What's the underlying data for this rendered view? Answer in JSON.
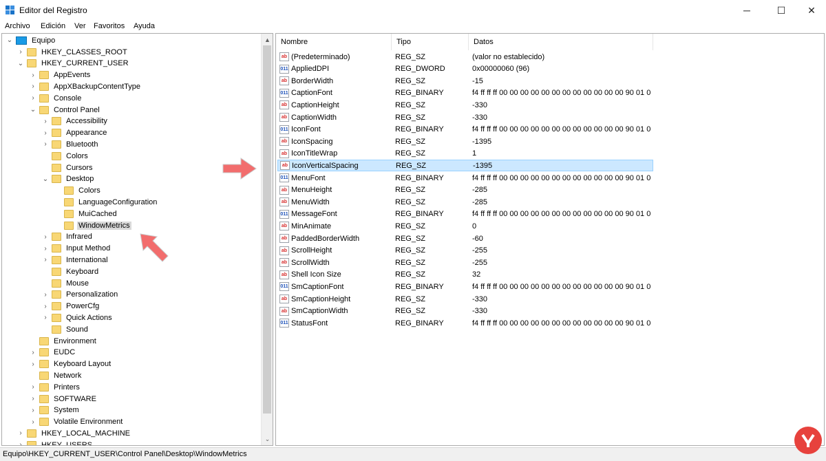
{
  "window": {
    "title": "Editor del Registro",
    "minimize": "─",
    "maximize": "☐",
    "close": "✕"
  },
  "menu": [
    "Archivo",
    "Edición",
    "Ver",
    "Favoritos",
    "Ayuda"
  ],
  "tree": {
    "root": "Equipo",
    "items": [
      {
        "label": "HKEY_CLASSES_ROOT",
        "level": 1,
        "expander": "›"
      },
      {
        "label": "HKEY_CURRENT_USER",
        "level": 1,
        "expander": "⌄"
      },
      {
        "label": "AppEvents",
        "level": 2,
        "expander": "›"
      },
      {
        "label": "AppXBackupContentType",
        "level": 2,
        "expander": "›"
      },
      {
        "label": "Console",
        "level": 2,
        "expander": "›"
      },
      {
        "label": "Control Panel",
        "level": 2,
        "expander": "⌄"
      },
      {
        "label": "Accessibility",
        "level": 3,
        "expander": "›"
      },
      {
        "label": "Appearance",
        "level": 3,
        "expander": "›"
      },
      {
        "label": "Bluetooth",
        "level": 3,
        "expander": "›"
      },
      {
        "label": "Colors",
        "level": 3,
        "expander": ""
      },
      {
        "label": "Cursors",
        "level": 3,
        "expander": ""
      },
      {
        "label": "Desktop",
        "level": 3,
        "expander": "⌄"
      },
      {
        "label": "Colors",
        "level": 4,
        "expander": ""
      },
      {
        "label": "LanguageConfiguration",
        "level": 4,
        "expander": ""
      },
      {
        "label": "MuiCached",
        "level": 4,
        "expander": ""
      },
      {
        "label": "WindowMetrics",
        "level": 4,
        "expander": "",
        "selected": true
      },
      {
        "label": "Infrared",
        "level": 3,
        "expander": "›"
      },
      {
        "label": "Input Method",
        "level": 3,
        "expander": "›"
      },
      {
        "label": "International",
        "level": 3,
        "expander": "›"
      },
      {
        "label": "Keyboard",
        "level": 3,
        "expander": ""
      },
      {
        "label": "Mouse",
        "level": 3,
        "expander": ""
      },
      {
        "label": "Personalization",
        "level": 3,
        "expander": "›"
      },
      {
        "label": "PowerCfg",
        "level": 3,
        "expander": "›"
      },
      {
        "label": "Quick Actions",
        "level": 3,
        "expander": "›"
      },
      {
        "label": "Sound",
        "level": 3,
        "expander": ""
      },
      {
        "label": "Environment",
        "level": 2,
        "expander": ""
      },
      {
        "label": "EUDC",
        "level": 2,
        "expander": "›"
      },
      {
        "label": "Keyboard Layout",
        "level": 2,
        "expander": "›"
      },
      {
        "label": "Network",
        "level": 2,
        "expander": ""
      },
      {
        "label": "Printers",
        "level": 2,
        "expander": "›"
      },
      {
        "label": "SOFTWARE",
        "level": 2,
        "expander": "›"
      },
      {
        "label": "System",
        "level": 2,
        "expander": "›"
      },
      {
        "label": "Volatile Environment",
        "level": 2,
        "expander": "›"
      },
      {
        "label": "HKEY_LOCAL_MACHINE",
        "level": 1,
        "expander": "›"
      },
      {
        "label": "HKEY_USERS",
        "level": 1,
        "expander": "›"
      }
    ]
  },
  "scrollbar": {
    "up": "▲",
    "down": "⌄"
  },
  "list": {
    "columns": [
      "Nombre",
      "Tipo",
      "Datos"
    ],
    "rows": [
      {
        "icon": "string-value-icon",
        "name": "(Predeterminado)",
        "type": "REG_SZ",
        "data": "(valor no establecido)"
      },
      {
        "icon": "binary-value-icon",
        "name": "AppliedDPI",
        "type": "REG_DWORD",
        "data": "0x00000060 (96)"
      },
      {
        "icon": "string-value-icon",
        "name": "BorderWidth",
        "type": "REG_SZ",
        "data": "-15"
      },
      {
        "icon": "binary-value-icon",
        "name": "CaptionFont",
        "type": "REG_BINARY",
        "data": "f4 ff ff ff 00 00 00 00 00 00 00 00 00 00 00 00 90 01 0..."
      },
      {
        "icon": "string-value-icon",
        "name": "CaptionHeight",
        "type": "REG_SZ",
        "data": "-330"
      },
      {
        "icon": "string-value-icon",
        "name": "CaptionWidth",
        "type": "REG_SZ",
        "data": "-330"
      },
      {
        "icon": "binary-value-icon",
        "name": "IconFont",
        "type": "REG_BINARY",
        "data": "f4 ff ff ff 00 00 00 00 00 00 00 00 00 00 00 00 90 01 0..."
      },
      {
        "icon": "string-value-icon",
        "name": "IconSpacing",
        "type": "REG_SZ",
        "data": "-1395"
      },
      {
        "icon": "string-value-icon",
        "name": "IconTitleWrap",
        "type": "REG_SZ",
        "data": "1"
      },
      {
        "icon": "string-value-icon",
        "name": "IconVerticalSpacing",
        "type": "REG_SZ",
        "data": "-1395",
        "selected": true
      },
      {
        "icon": "binary-value-icon",
        "name": "MenuFont",
        "type": "REG_BINARY",
        "data": "f4 ff ff ff 00 00 00 00 00 00 00 00 00 00 00 00 90 01 0..."
      },
      {
        "icon": "string-value-icon",
        "name": "MenuHeight",
        "type": "REG_SZ",
        "data": "-285"
      },
      {
        "icon": "string-value-icon",
        "name": "MenuWidth",
        "type": "REG_SZ",
        "data": "-285"
      },
      {
        "icon": "binary-value-icon",
        "name": "MessageFont",
        "type": "REG_BINARY",
        "data": "f4 ff ff ff 00 00 00 00 00 00 00 00 00 00 00 00 90 01 0..."
      },
      {
        "icon": "string-value-icon",
        "name": "MinAnimate",
        "type": "REG_SZ",
        "data": "0"
      },
      {
        "icon": "string-value-icon",
        "name": "PaddedBorderWidth",
        "type": "REG_SZ",
        "data": "-60"
      },
      {
        "icon": "string-value-icon",
        "name": "ScrollHeight",
        "type": "REG_SZ",
        "data": "-255"
      },
      {
        "icon": "string-value-icon",
        "name": "ScrollWidth",
        "type": "REG_SZ",
        "data": "-255"
      },
      {
        "icon": "string-value-icon",
        "name": "Shell Icon Size",
        "type": "REG_SZ",
        "data": "32"
      },
      {
        "icon": "binary-value-icon",
        "name": "SmCaptionFont",
        "type": "REG_BINARY",
        "data": "f4 ff ff ff 00 00 00 00 00 00 00 00 00 00 00 00 90 01 0..."
      },
      {
        "icon": "string-value-icon",
        "name": "SmCaptionHeight",
        "type": "REG_SZ",
        "data": "-330"
      },
      {
        "icon": "string-value-icon",
        "name": "SmCaptionWidth",
        "type": "REG_SZ",
        "data": "-330"
      },
      {
        "icon": "binary-value-icon",
        "name": "StatusFont",
        "type": "REG_BINARY",
        "data": "f4 ff ff ff 00 00 00 00 00 00 00 00 00 00 00 00 90 01 0..."
      }
    ]
  },
  "icon_glyphs": {
    "string": "ab",
    "binary": "011"
  },
  "status": {
    "path": "Equipo\\HKEY_CURRENT_USER\\Control Panel\\Desktop\\WindowMetrics"
  },
  "colors": {
    "selection": "#cce8ff",
    "selection_border": "#99d1ff",
    "tree_selection": "#d9d9d9",
    "folder": "#f8d775",
    "annotation_arrow": "#f26d6d"
  }
}
